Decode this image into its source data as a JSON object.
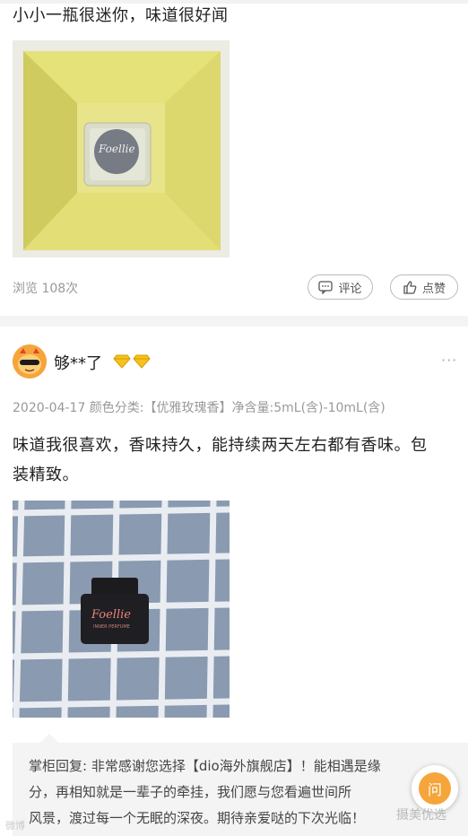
{
  "review1": {
    "text": "小小一瓶很迷你，味道很好闻",
    "bottle_brand": "Foellie",
    "views": "浏览 108次",
    "comment_label": "评论",
    "like_label": "点赞"
  },
  "review2": {
    "username": "够**了",
    "meta": "2020-04-17 颜色分类:【优雅玫瑰香】净含量:5mL(含)-10mL(含)",
    "text_line1": "味道我很喜欢，香味持久，能持续两天左右都有香味。包",
    "text_line2": "装精致。",
    "bottle_brand": "Foellie",
    "bottle_sub": "INNER PERFUME",
    "more_label": "···"
  },
  "reply": {
    "line1": "掌柜回复: 非常感谢您选择【dio海外旗舰店】！能相遇是缘",
    "line2": "分，再相知就是一辈子的牵挂，我们愿与您看遍世间所",
    "line3": "风景，渡过每一个无眠的深夜。期待亲爱哒的下次光临！"
  },
  "ask_button_label": "问",
  "watermark_right": "摄美优选",
  "watermark_left": "微博",
  "colors": {
    "accent_orange": "#f5a53a",
    "box_yellow": "#e3de6d",
    "gem_gold": "#f6c31b"
  }
}
